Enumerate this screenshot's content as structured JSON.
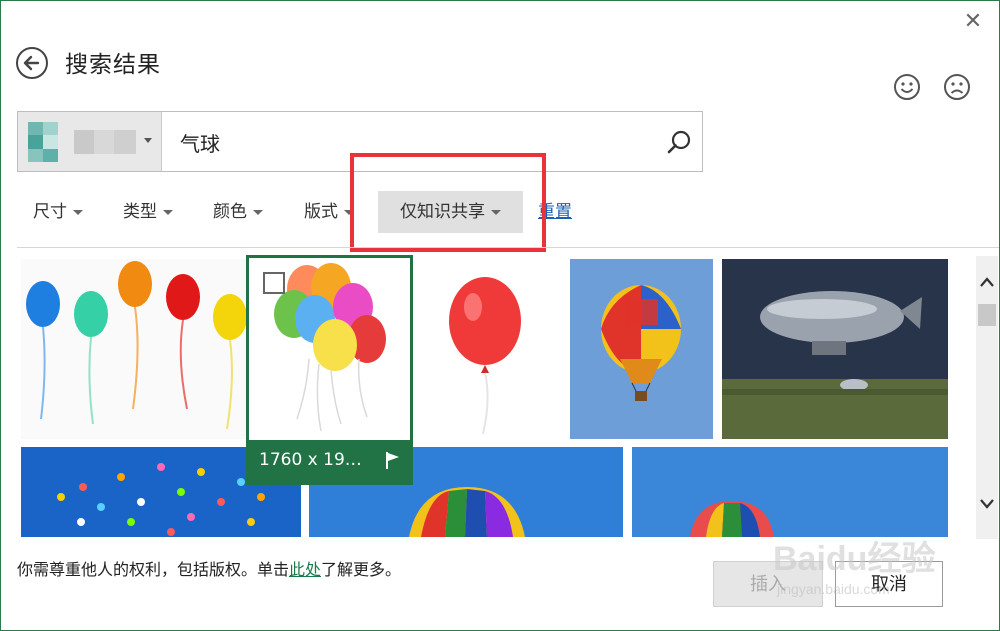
{
  "dialog": {
    "title": "搜索结果",
    "close_glyph": "✕"
  },
  "feedback": {
    "happy_icon": "smile-icon",
    "sad_icon": "frown-icon"
  },
  "search": {
    "query": "气球",
    "source_icon": "search-source-logo"
  },
  "filters": {
    "size": "尺寸",
    "type": "类型",
    "color": "颜色",
    "layout": "版式",
    "creative_commons": "仅知识共享",
    "reset": "重置"
  },
  "selected_image": {
    "dimensions": "1760 x 19…"
  },
  "footer": {
    "notice_prefix": "你需尊重他人的权利，包括版权。单击",
    "notice_link": "此处",
    "notice_suffix": "了解更多。",
    "insert_label": "插入",
    "cancel_label": "取消"
  },
  "watermark": {
    "brand": "Baidu经验",
    "url": "jingyan.baidu.com"
  },
  "colors": {
    "accent_green": "#217346",
    "highlight_red": "#e8333a",
    "link_blue": "#1a5fb4"
  }
}
